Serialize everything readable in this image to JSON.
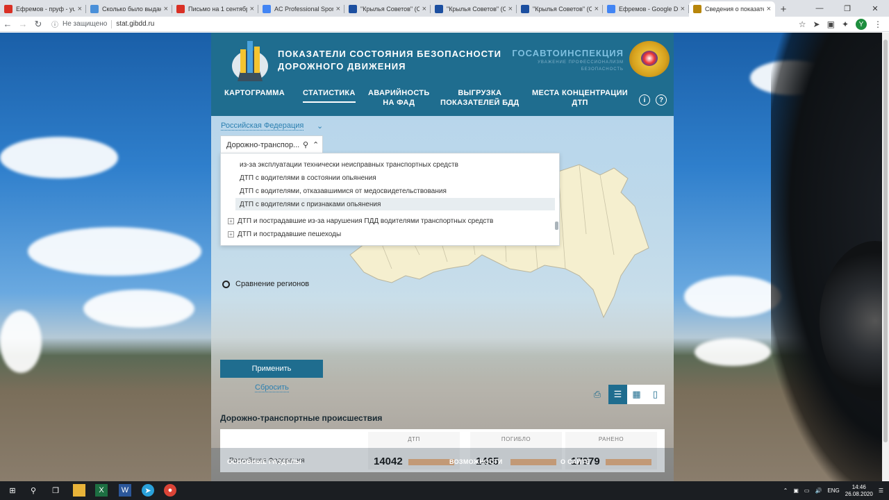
{
  "browser": {
    "tabs": [
      {
        "title": "Ефремов - пруф - yuliy",
        "icon": "gmail-icon",
        "color": "#d93025"
      },
      {
        "title": "Сколько было выдано",
        "icon": "page-icon",
        "color": "#4a90d9"
      },
      {
        "title": "Письмо на 1 сентябр",
        "icon": "gmail-icon",
        "color": "#d93025"
      },
      {
        "title": "AC Professional Sport",
        "icon": "google-icon",
        "color": "#4285f4"
      },
      {
        "title": "\"Крылья Советов\" (Са",
        "icon": "ks-icon",
        "color": "#1c4fa0"
      },
      {
        "title": "\"Крылья Советов\" (Са",
        "icon": "ks-icon",
        "color": "#1c4fa0"
      },
      {
        "title": "\"Крылья Советов\" (Са",
        "icon": "ks-icon",
        "color": "#1c4fa0"
      },
      {
        "title": "Ефремов - Google Doc",
        "icon": "docs-icon",
        "color": "#4285f4"
      },
      {
        "title": "Сведения о показател",
        "icon": "gibdd-icon",
        "color": "#b8860b",
        "active": true
      }
    ],
    "security": "Не защищено",
    "url": "stat.gibdd.ru",
    "profile_letter": "Y"
  },
  "site": {
    "title_line1": "ПОКАЗАТЕЛИ СОСТОЯНИЯ БЕЗОПАСНОСТИ",
    "title_line2": "ДОРОЖНОГО ДВИЖЕНИЯ",
    "gai_name": "ГОСАВТОИНСПЕКЦИЯ",
    "gai_slogan1": "УВАЖЕНИЕ ПРОФЕССИОНАЛИЗМ",
    "gai_slogan2": "БЕЗОПАСНОСТЬ",
    "nav": {
      "kartogramma": "КАРТОГРАММА",
      "statistika": "СТАТИСТИКА",
      "avar1": "АВАРИЙНОСТЬ",
      "avar2": "НА ФАД",
      "vygruzka1": "ВЫГРУЗКА",
      "vygruzka2": "ПОКАЗАТЕЛЕЙ БДД",
      "mesta1": "МЕСТА КОНЦЕНТРАЦИИ",
      "mesta2": "ДТП",
      "info": "i",
      "help": "?"
    }
  },
  "filters": {
    "region": "Российская Федерация",
    "indicator": "Дорожно-транспор...",
    "dropdown_items": [
      {
        "label": "из-за эксплуатации технически неисправных транспортных средств",
        "type": "sub"
      },
      {
        "label": "ДТП с водителями в состоянии опьянения",
        "type": "sub"
      },
      {
        "label": "ДТП с водителями, отказавшимися от медосвидетельствования",
        "type": "sub"
      },
      {
        "label": "ДТП с водителями с признаками опьянения",
        "type": "selected"
      },
      {
        "label": "ДТП и пострадавшие из-за нарушения ПДД водителями транспортных средств",
        "type": "group"
      },
      {
        "label": "ДТП и пострадавшие пешеходы",
        "type": "group"
      }
    ],
    "compare_label": "Сравнение регионов",
    "apply": "Применить",
    "reset": "Сбросить"
  },
  "results": {
    "section_title": "Дорожно-транспортные происшествия",
    "region": "Российская Федерация",
    "columns": [
      {
        "header": "ДТП",
        "value": "14042"
      },
      {
        "header": "ПОГИБЛО",
        "value": "1465"
      },
      {
        "header": "РАНЕНО",
        "value": "17979"
      }
    ]
  },
  "footer": {
    "sections": "ОСНОВНЫЕ РАЗДЕЛЫ",
    "features": "ВОЗМОЖНОСТИ",
    "about": "О САЙТЕ"
  },
  "taskbar": {
    "lang": "ENG",
    "time": "14:46",
    "date": "26.08.2020"
  }
}
